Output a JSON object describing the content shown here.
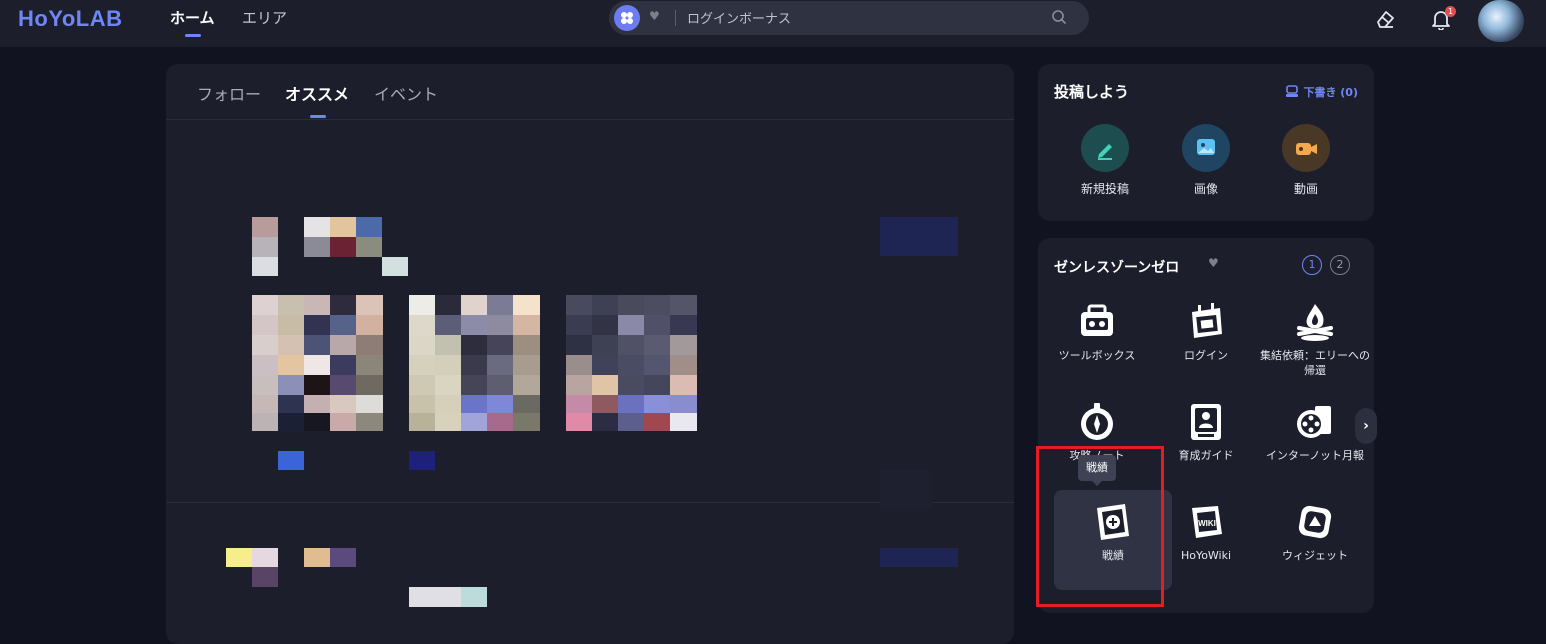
{
  "header": {
    "logo": "HoYoLAB",
    "nav": [
      {
        "label": "ホーム",
        "active": true
      },
      {
        "label": "エリア",
        "active": false
      }
    ],
    "search": {
      "placeholder": "ログインボーナス"
    },
    "notification_count": "1",
    "icons": [
      "grid-icon",
      "heart-icon",
      "search-icon",
      "eraser-icon",
      "bell-icon"
    ]
  },
  "feed": {
    "tabs": [
      {
        "label": "フォロー",
        "active": false
      },
      {
        "label": "オススメ",
        "active": true
      },
      {
        "label": "イベント",
        "active": false
      }
    ]
  },
  "post": {
    "title": "投稿しよう",
    "drafts": "下書き (0)",
    "buttons": [
      {
        "label": "新規投稿",
        "icon": "pen-icon",
        "color": "#1d9e8e"
      },
      {
        "label": "画像",
        "icon": "image-icon",
        "color": "#3aa5e6"
      },
      {
        "label": "動画",
        "icon": "video-icon",
        "color": "#f0a040"
      }
    ]
  },
  "game": {
    "title": "ゼンレスゾーンゼロ",
    "pages": [
      "1",
      "2"
    ],
    "tools": [
      {
        "label": "ツールボックス",
        "icon": "toolbox-icon"
      },
      {
        "label": "ログイン",
        "icon": "login-calendar-icon"
      },
      {
        "label": "集結依頼：エリーへの帰還",
        "icon": "campfire-icon"
      },
      {
        "label": "攻略ノート",
        "icon": "compass-icon"
      },
      {
        "label": "育成ガイド",
        "icon": "guide-icon"
      },
      {
        "label": "インターノット月報",
        "icon": "film-reel-icon"
      },
      {
        "label": "戦績",
        "icon": "battle-record-icon"
      },
      {
        "label": "HoYoWiki",
        "icon": "wiki-icon"
      },
      {
        "label": "ウィジェット",
        "icon": "widget-icon"
      }
    ],
    "tooltip": "戦績"
  },
  "colors": {
    "accent": "#6f86f5",
    "highlight": "#e51c23",
    "background": "#111420",
    "panel": "#1c1e2b"
  }
}
